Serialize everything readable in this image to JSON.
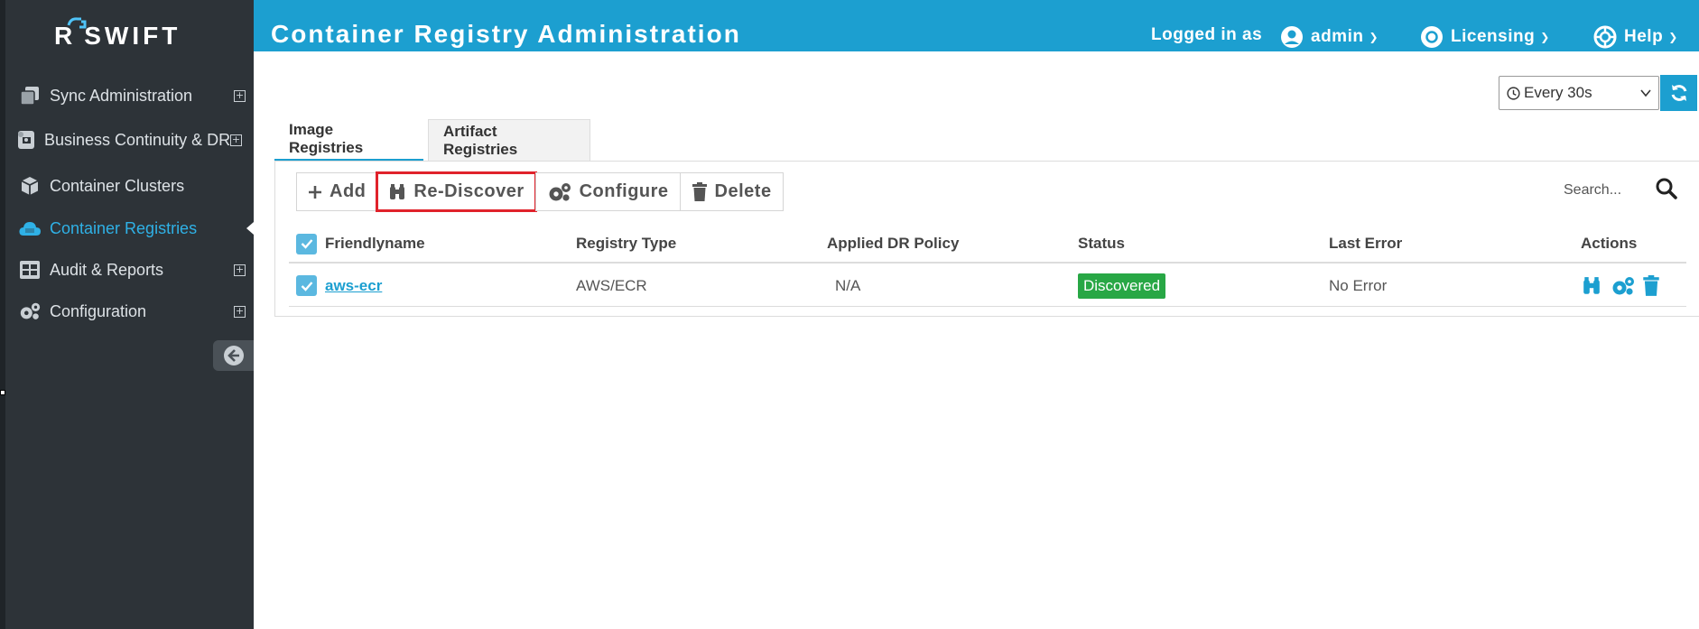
{
  "app": {
    "logo_prefix": "R",
    "logo_text": "SWIFT",
    "page_title": "Container Registry Administration"
  },
  "header": {
    "logged_in_label": "Logged in as",
    "user": "admin",
    "licensing": "Licensing",
    "help": "Help"
  },
  "sidebar": {
    "items": [
      {
        "label": "Sync Administration",
        "icon": "copy-icon",
        "expandable": true
      },
      {
        "label": "Business Continuity & DR",
        "icon": "scroll-icon",
        "expandable": true
      },
      {
        "label": "Container Clusters",
        "icon": "cube-icon",
        "expandable": false
      },
      {
        "label": "Container Registries",
        "icon": "cloud-icon",
        "expandable": false,
        "active": true
      },
      {
        "label": "Audit & Reports",
        "icon": "table-icon",
        "expandable": true
      },
      {
        "label": "Configuration",
        "icon": "cogs-icon",
        "expandable": true
      }
    ]
  },
  "refresh": {
    "selected": "Every 30s"
  },
  "tabs": [
    {
      "label": "Image Registries",
      "active": true
    },
    {
      "label": "Artifact Registries",
      "active": false
    }
  ],
  "toolbar": {
    "add": "Add",
    "rediscover": "Re-Discover",
    "configure": "Configure",
    "delete": "Delete"
  },
  "search": {
    "placeholder": "Search..."
  },
  "table": {
    "columns": [
      "Friendlyname",
      "Registry Type",
      "Applied DR Policy",
      "Status",
      "Last Error",
      "Actions"
    ],
    "rows": [
      {
        "friendlyname": "aws-ecr",
        "registry_type": "AWS/ECR",
        "dr_policy": "N/A",
        "status": "Discovered",
        "last_error": "No Error"
      }
    ]
  },
  "colors": {
    "accent": "#1c9fd0",
    "sidebar_bg": "#2d3338",
    "status_ok": "#28a745",
    "highlight": "#e0222b"
  }
}
